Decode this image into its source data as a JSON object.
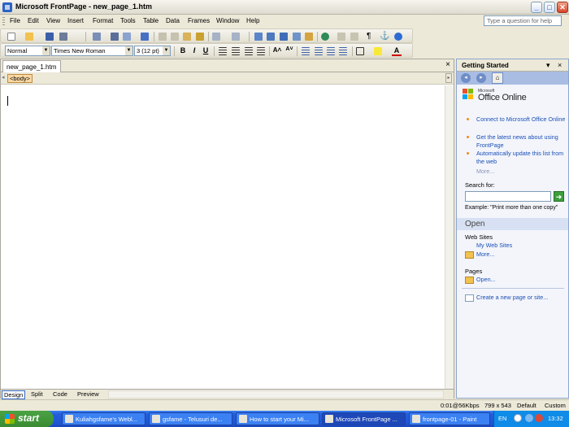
{
  "window": {
    "title": "Microsoft FrontPage - new_page_1.htm",
    "controls": [
      "_",
      "□",
      "✕"
    ]
  },
  "menu": [
    "File",
    "Edit",
    "View",
    "Insert",
    "Format",
    "Tools",
    "Table",
    "Data",
    "Frames",
    "Window",
    "Help"
  ],
  "ask_box": {
    "placeholder": "Type a question for help"
  },
  "formatting": {
    "style": "Normal",
    "font": "Times New Roman",
    "size": "3  (12 pt)"
  },
  "document": {
    "tab_label": "new_page_1.htm",
    "close": "×",
    "tag_chip": "<body>",
    "view_tabs": [
      "Design",
      "Split",
      "Code",
      "Preview"
    ]
  },
  "task_pane": {
    "title": "Getting Started",
    "office_online_small": "Microsoft",
    "office_online": "Office Online",
    "links": [
      "Connect to Microsoft Office Online",
      "Get the latest news about using FrontPage",
      "Automatically update this list from the web"
    ],
    "more": "More...",
    "search_label": "Search for:",
    "example": "Example:  \"Print more than one copy\"",
    "open_section": "Open",
    "web_sites_label": "Web Sites",
    "my_web_sites": "My Web Sites",
    "web_more": "More...",
    "pages_label": "Pages",
    "pages_open": "Open...",
    "create_link": "Create a new page or site..."
  },
  "status": {
    "speed": "0:01@56Kbps",
    "resolution": "799 x 543",
    "mode1": "Default",
    "mode2": "Custom"
  },
  "taskbar": {
    "start": "start",
    "buttons": [
      "Kuliahgsfame's Webl...",
      "gsfame - Telusuri de...",
      "How to start your Mi...",
      "Microsoft FrontPage ...",
      "frontpage-01 - Paint"
    ],
    "lang": "EN",
    "clock": "13:32"
  }
}
